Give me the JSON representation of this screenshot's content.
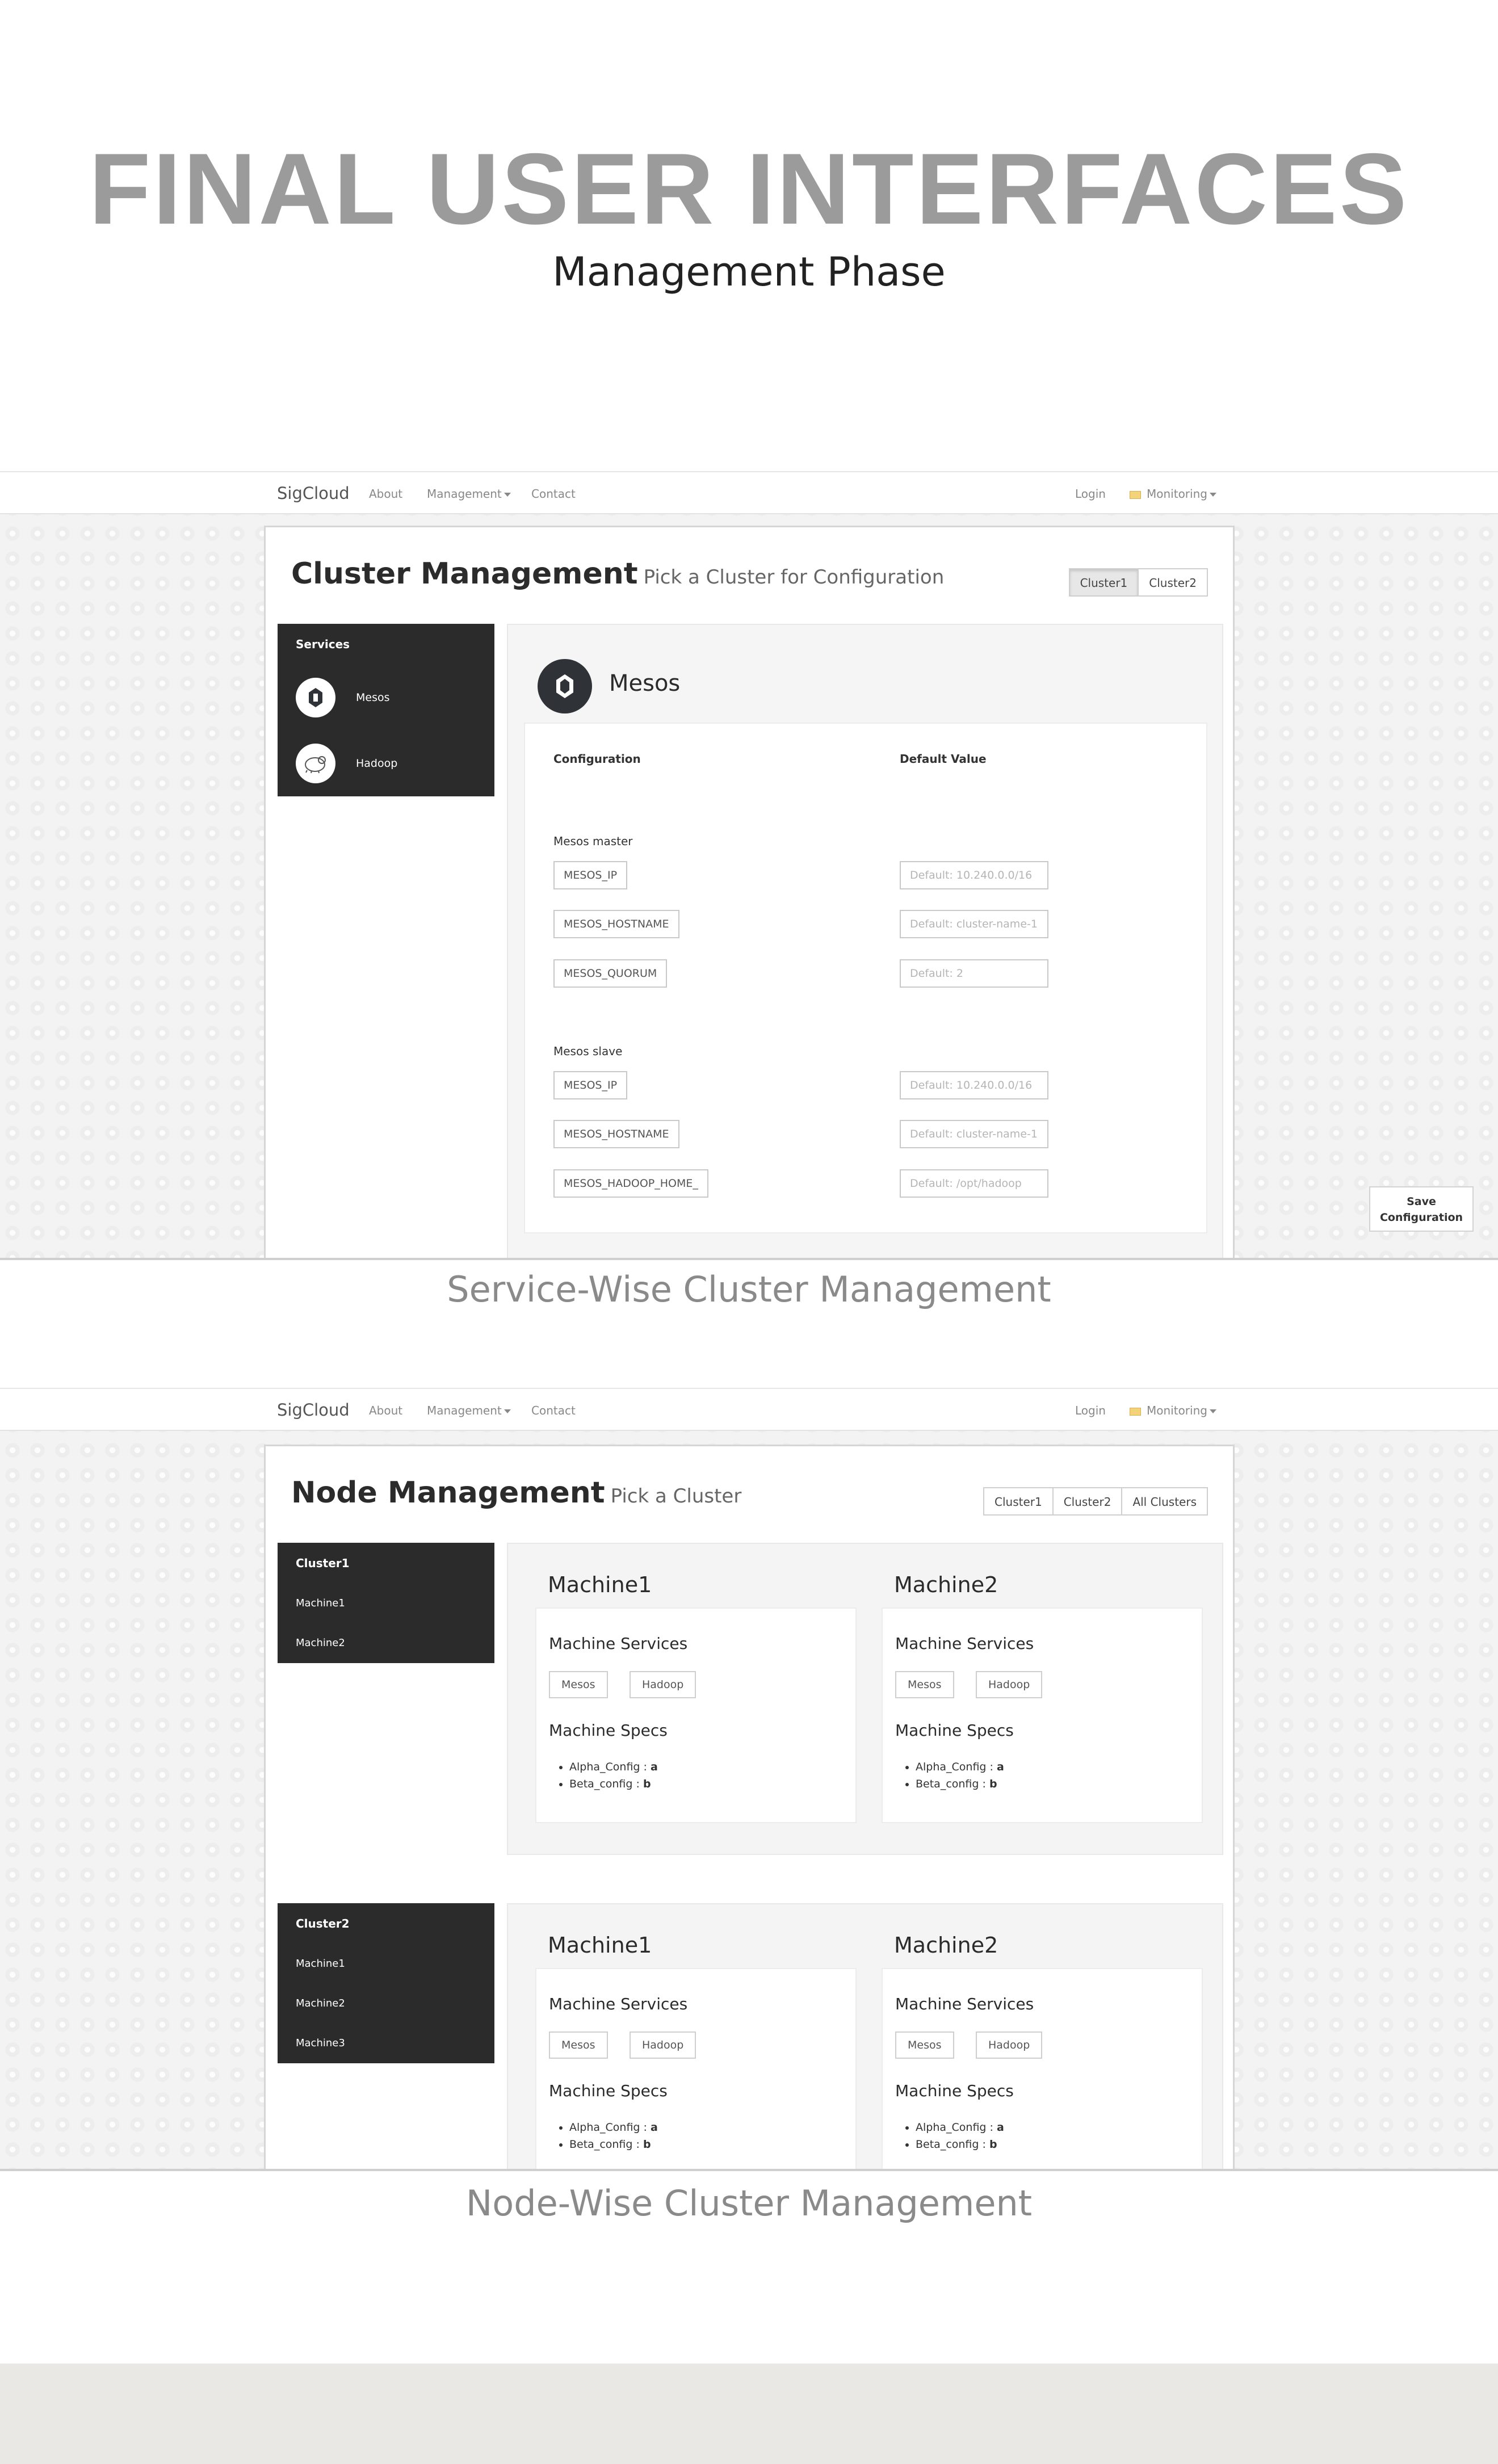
{
  "page": {
    "title": "FINAL USER INTERFACES",
    "subtitle": "Management Phase",
    "caption_1": "Service-Wise Cluster Management",
    "caption_2": "Node-Wise Cluster Management"
  },
  "nav": {
    "brand": "SigCloud",
    "about": "About",
    "management": "Management",
    "contact": "Contact",
    "login": "Login",
    "monitoring": "Monitoring"
  },
  "cluster_mgmt": {
    "title": "Cluster Management",
    "subtitle": "Pick a Cluster for Configuration",
    "cluster_buttons": [
      "Cluster1",
      "Cluster2"
    ],
    "active_cluster": "Cluster1",
    "sidebar_head": "Services",
    "services": [
      {
        "label": "Mesos",
        "icon": "mesos-icon"
      },
      {
        "label": "Hadoop",
        "icon": "hadoop-icon"
      }
    ],
    "service_title": "Mesos",
    "col_config": "Configuration",
    "col_default": "Default Value",
    "master_label": "Mesos master",
    "master_fields": [
      {
        "name": "MESOS_IP",
        "default": "Default: 10.240.0.0/16"
      },
      {
        "name": "MESOS_HOSTNAME",
        "default": "Default: cluster-name-1"
      },
      {
        "name": "MESOS_QUORUM",
        "default": "Default: 2"
      }
    ],
    "slave_label": "Mesos slave",
    "slave_fields": [
      {
        "name": "MESOS_IP",
        "default": "Default: 10.240.0.0/16"
      },
      {
        "name": "MESOS_HOSTNAME",
        "default": "Default: cluster-name-1"
      },
      {
        "name": "MESOS_HADOOP_HOME_",
        "default": "Default: /opt/hadoop"
      }
    ],
    "save_line1": "Save",
    "save_line2": "Configuration"
  },
  "node_mgmt": {
    "title": "Node Management",
    "subtitle": "Pick a Cluster",
    "cluster_buttons": [
      "Cluster1",
      "Cluster2",
      "All Clusters"
    ],
    "clusters": [
      {
        "name": "Cluster1",
        "machines_nav": [
          "Machine1",
          "Machine2"
        ],
        "machines": [
          {
            "name": "Machine1",
            "services_label": "Machine Services",
            "services": [
              "Mesos",
              "Hadoop"
            ],
            "specs_label": "Machine Specs",
            "specs": [
              {
                "key": "Alpha_Config",
                "value": "a"
              },
              {
                "key": "Beta_config",
                "value": "b"
              }
            ]
          },
          {
            "name": "Machine2",
            "services_label": "Machine Services",
            "services": [
              "Mesos",
              "Hadoop"
            ],
            "specs_label": "Machine Specs",
            "specs": [
              {
                "key": "Alpha_Config",
                "value": "a"
              },
              {
                "key": "Beta_config",
                "value": "b"
              }
            ]
          }
        ]
      },
      {
        "name": "Cluster2",
        "machines_nav": [
          "Machine1",
          "Machine2",
          "Machine3"
        ],
        "machines": [
          {
            "name": "Machine1",
            "services_label": "Machine Services",
            "services": [
              "Mesos",
              "Hadoop"
            ],
            "specs_label": "Machine Specs",
            "specs": [
              {
                "key": "Alpha_Config",
                "value": "a"
              },
              {
                "key": "Beta_config",
                "value": "b"
              }
            ]
          },
          {
            "name": "Machine2",
            "services_label": "Machine Services",
            "services": [
              "Mesos",
              "Hadoop"
            ],
            "specs_label": "Machine Specs",
            "specs": [
              {
                "key": "Alpha_Config",
                "value": "a"
              },
              {
                "key": "Beta_config",
                "value": "b"
              }
            ]
          }
        ]
      }
    ]
  }
}
